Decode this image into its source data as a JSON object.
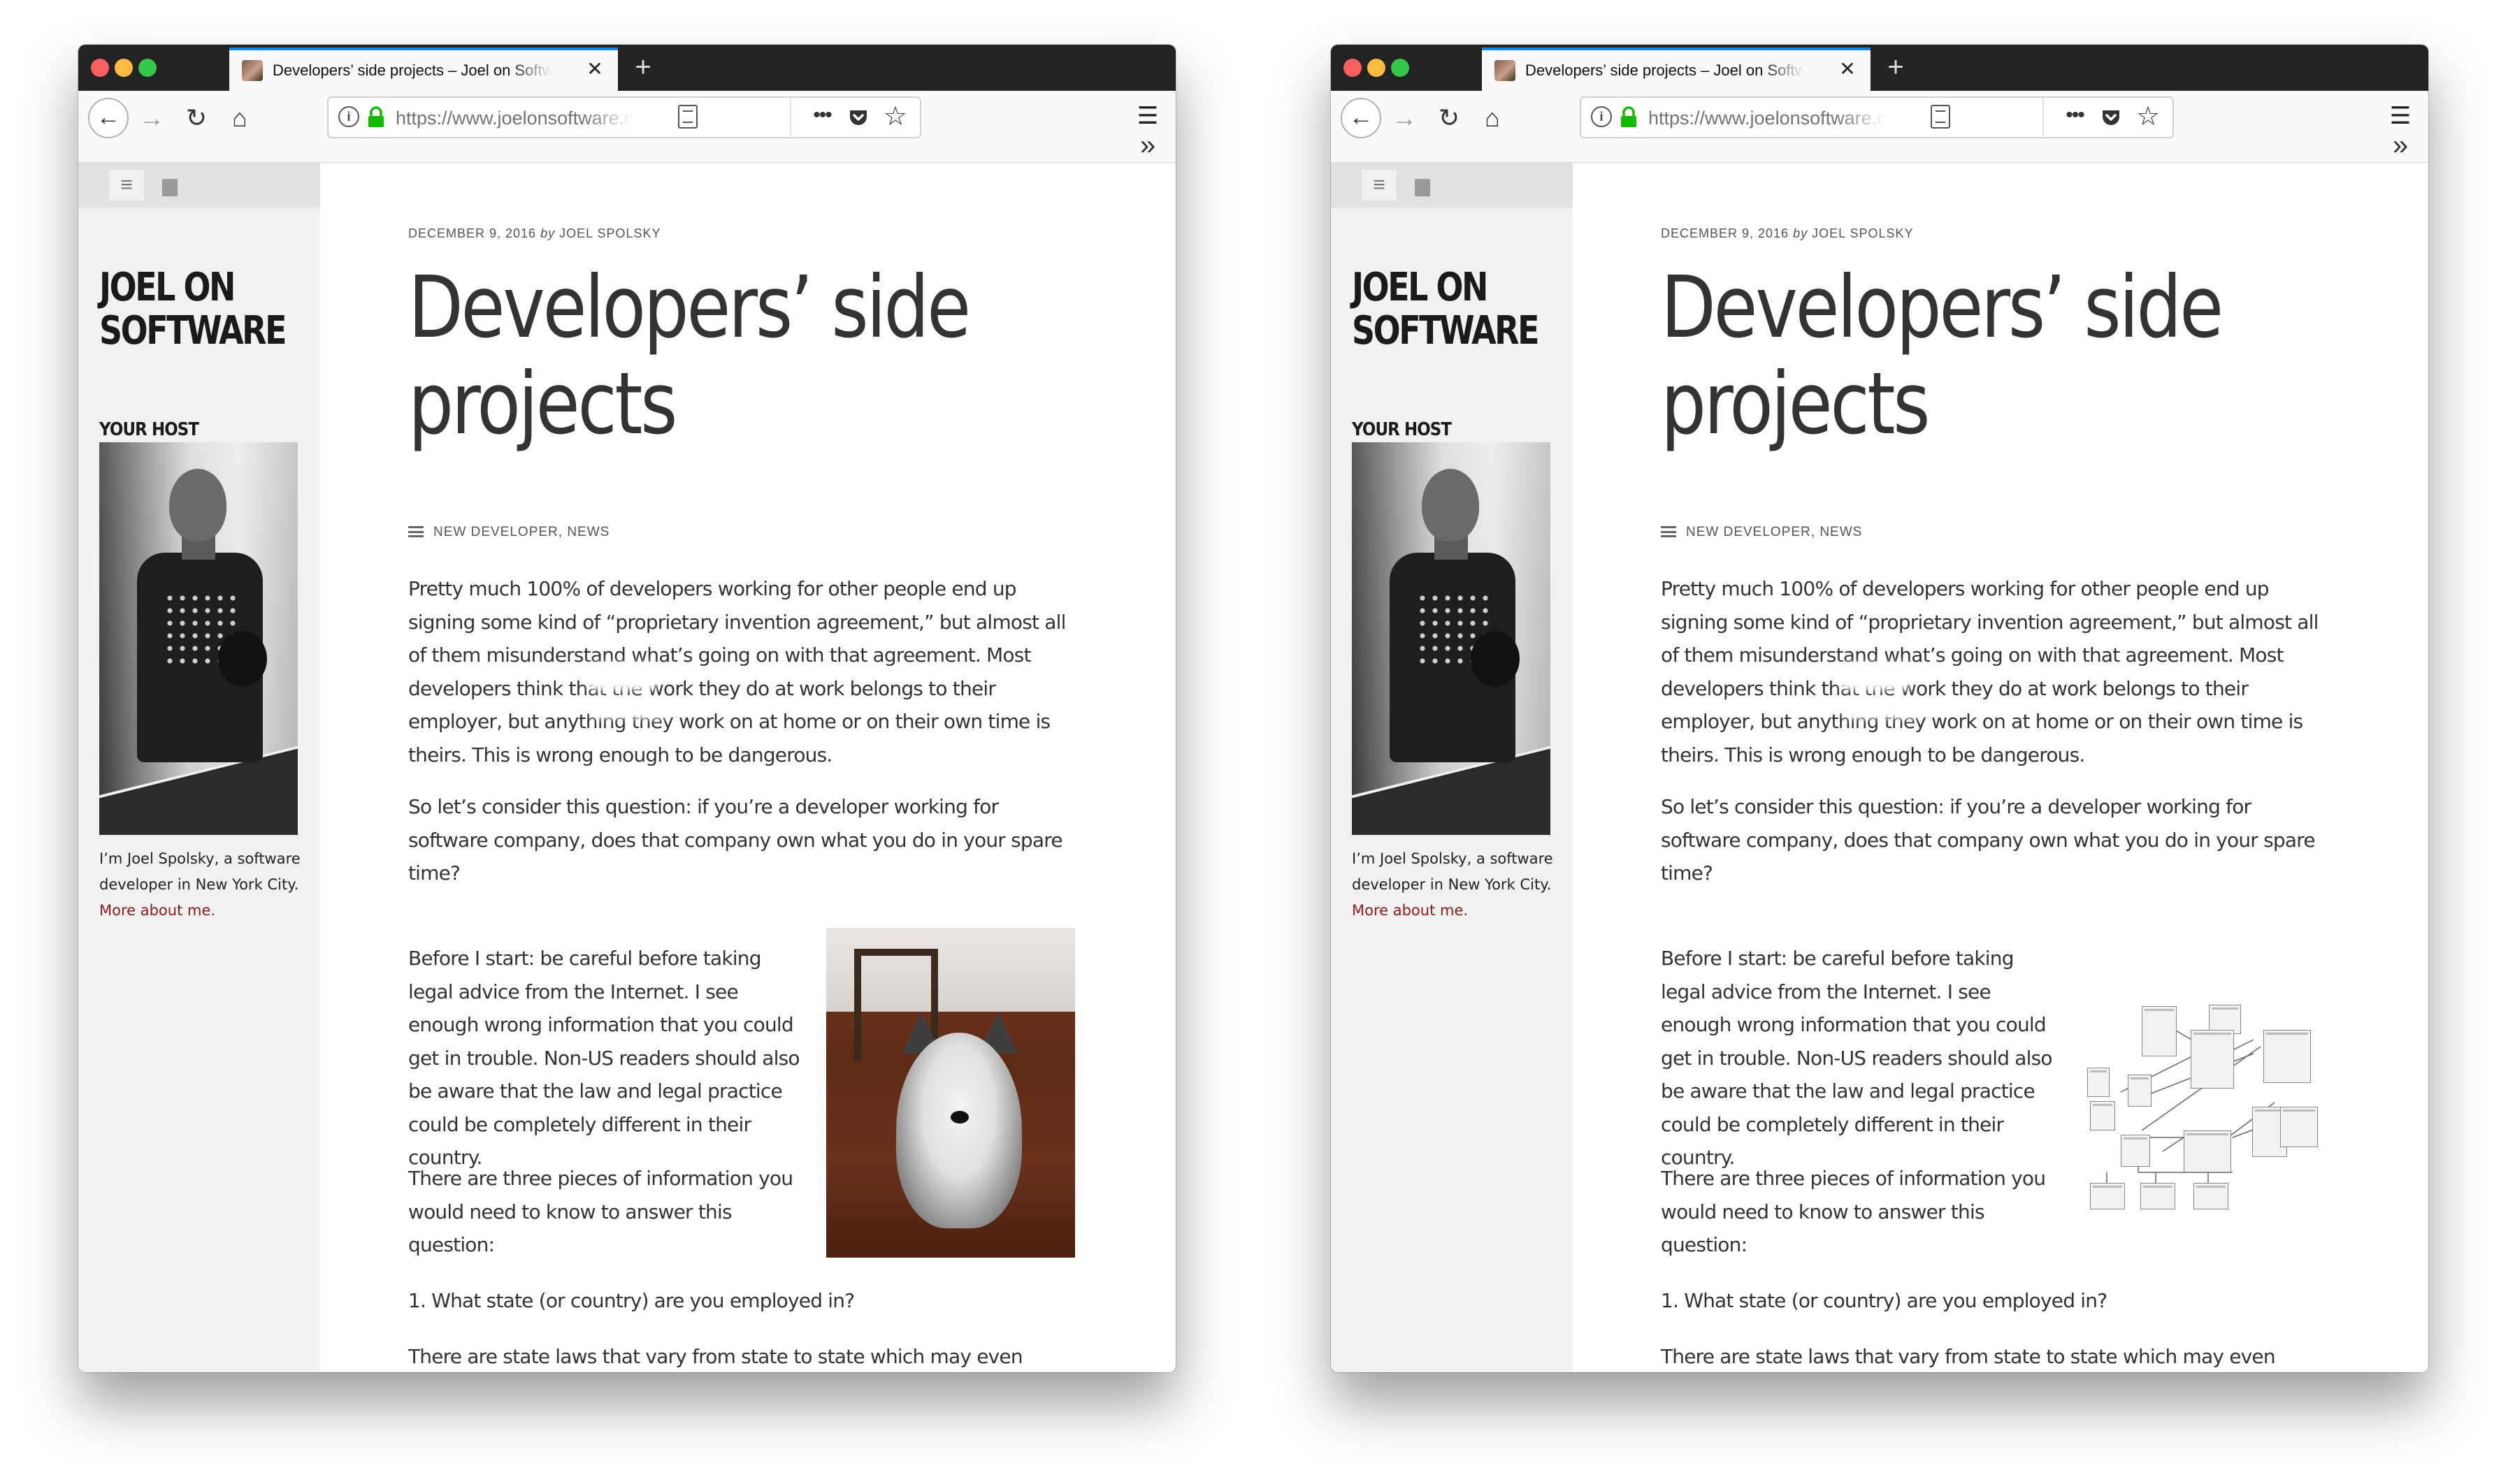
{
  "browser": {
    "tab_title": "Developers’ side projects – Joel on Software",
    "tab_close_glyph": "✕",
    "new_tab_glyph": "+",
    "url": "https://www.joelonsoftware.com",
    "more_glyph": "•••",
    "star_glyph": "☆",
    "menu_glyph": "☰",
    "overflow_glyph": "»",
    "back_glyph": "←",
    "forward_glyph": "→",
    "reload_glyph": "↻",
    "home_glyph": "⌂",
    "icons": [
      "info-icon",
      "lock-icon",
      "reader-view-icon",
      "page-actions-icon",
      "pocket-icon",
      "bookmark-star-icon",
      "hamburger-menu-icon",
      "overflow-chevron-icon"
    ]
  },
  "sidebar": {
    "menu_glyph": "≡",
    "folder_glyph": "▆",
    "site_title_line1": "JOEL ON",
    "site_title_line2": "SOFTWARE",
    "host_label": "YOUR HOST",
    "bio_text": "I’m Joel Spolsky, a software developer in New York City.",
    "bio_link": "More about me."
  },
  "post": {
    "date": "DECEMBER 9, 2016",
    "by": "by",
    "author": "JOEL SPOLSKY",
    "title": "Developers’ side projects",
    "categories": "NEW DEVELOPER, NEWS",
    "p1": "Pretty much 100% of developers working for other people end up signing some kind of “proprietary invention agreement,” but almost all of them misunderstand what’s going on with that agreement. Most developers think that the work they do at work belongs to their employer, but anything they work on at home or on their own time is theirs. This is wrong enough to be dangerous.",
    "p2": "So let’s consider this question: if you’re a developer working for software company, does that company own what you do in your spare time?",
    "p3": "Before I start: be careful before taking legal advice from the Internet. I see enough wrong information that you could get in trouble. Non-US readers should also be aware that the law and legal practice could be completely different in their country.",
    "p4": "There are three pieces of information you would need to know to answer this question:",
    "p5": "1. What state (or country) are you employed in?",
    "p6": "There are state laws that vary from state to state which may even override specific contracts."
  },
  "colors": {
    "titlebar": "#232323",
    "active_tab_accent": "#0a84ff",
    "sidebar_bg": "#f1f1f1",
    "link": "#8b1c1c",
    "body_text": "#333333"
  }
}
